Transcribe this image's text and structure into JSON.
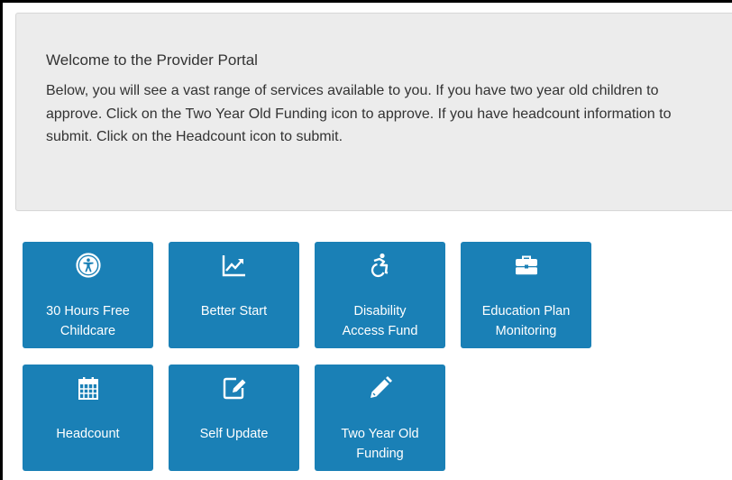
{
  "welcome": {
    "title": "Welcome to the Provider Portal",
    "body": "Below, you will see a vast range of services available to you. If you have two year old children to approve. Click on the Two Year Old Funding icon to approve. If you have headcount information to submit. Click on the Headcount icon to submit."
  },
  "colors": {
    "tile": "#1a80b6",
    "panel": "#ececec",
    "text": "#333333"
  },
  "tiles": [
    {
      "label": "30 Hours Free\nChildcare",
      "icon": "universal-access-icon"
    },
    {
      "label": "Better Start",
      "icon": "line-chart-icon"
    },
    {
      "label": "Disability\nAccess Fund",
      "icon": "wheelchair-icon"
    },
    {
      "label": "Education Plan\nMonitoring",
      "icon": "briefcase-icon"
    },
    {
      "label": "Headcount",
      "icon": "calendar-icon"
    },
    {
      "label": "Self Update",
      "icon": "edit-icon"
    },
    {
      "label": "Two Year Old\nFunding",
      "icon": "pencil-icon"
    }
  ]
}
